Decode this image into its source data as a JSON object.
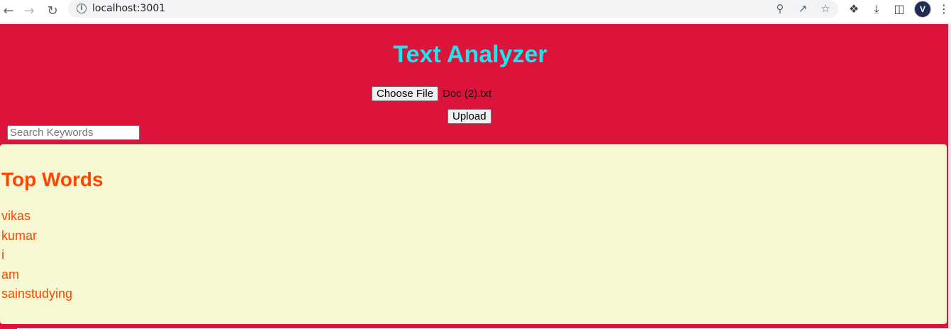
{
  "browser": {
    "url": "localhost:3001",
    "icons": {
      "back": "arrow-left-icon",
      "forward": "arrow-right-icon",
      "reload": "reload-icon",
      "info": "info-icon",
      "zoom": "zoom-icon",
      "share": "share-icon",
      "bookmark": "star-icon",
      "extensions": "puzzle-icon",
      "downloads": "download-icon",
      "side_panel": "side-panel-icon",
      "profile": "avatar",
      "menu": "kebab-menu-icon"
    },
    "avatar_letter": "V"
  },
  "header": {
    "title": "Text Analyzer",
    "title_color": "#19e6f0",
    "background_color": "#dc143c"
  },
  "upload_form": {
    "choose_file_label": "Choose File",
    "file_name": "Doc (2).txt",
    "upload_label": "Upload"
  },
  "search": {
    "placeholder": "Search Keywords",
    "value": ""
  },
  "top_words": {
    "heading": "Top Words",
    "accent_color": "#ff4500",
    "panel_color": "#f8f8d2",
    "items": [
      "vikas",
      "kumar",
      "i",
      "am",
      "sainstudying"
    ]
  }
}
